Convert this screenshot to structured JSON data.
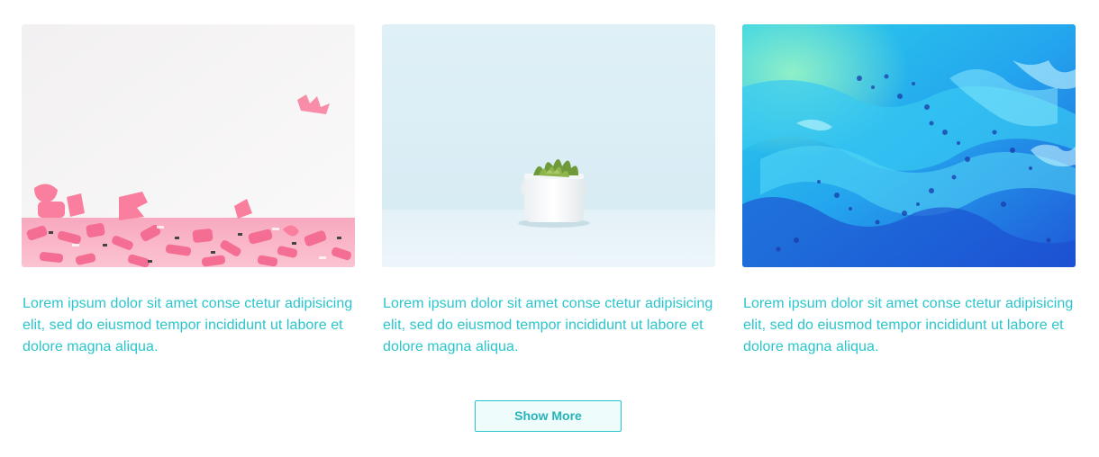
{
  "cards": [
    {
      "image_icon": "pink-letters-photo",
      "description": "Lorem ipsum dolor sit amet conse ctetur adipisicing elit, sed do eiusmod tempor incididunt ut labore et dolore magna aliqua."
    },
    {
      "image_icon": "potted-succulent-photo",
      "description": "Lorem ipsum dolor sit amet conse ctetur adipisicing elit, sed do eiusmod tempor incididunt ut labore et dolore magna aliqua."
    },
    {
      "image_icon": "blue-fluid-art-photo",
      "description": "Lorem ipsum dolor sit amet conse ctetur adipisicing elit, sed do eiusmod tempor incididunt ut labore et dolore magna aliqua."
    }
  ],
  "show_more_label": "Show More",
  "colors": {
    "accent": "#2ac5cc",
    "button_bg": "#eefcfc"
  }
}
